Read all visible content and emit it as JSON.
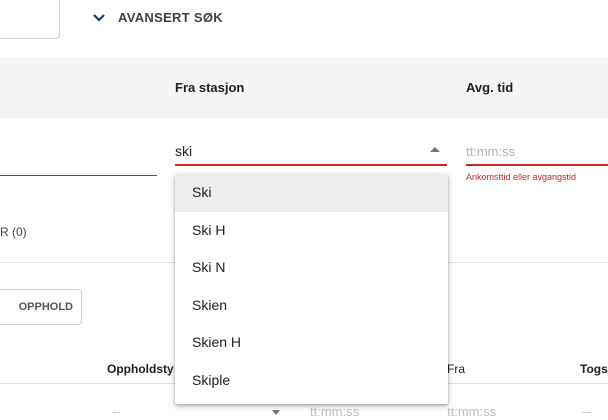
{
  "advanced": {
    "label": "AVANSERT SØK"
  },
  "table_header": {
    "fra": "Fra stasjon",
    "avg": "Avg. tid"
  },
  "fra_field": {
    "value": "ski"
  },
  "avg_field": {
    "placeholder": "tt:mm:ss",
    "error": "Ankomsttid eller avgangstid"
  },
  "count_label": "R (0)",
  "opphold_button": "OPPHOLD",
  "stops_header": {
    "oppholdstype": "Oppholdsty",
    "fra": "Fra",
    "togs": "Togs"
  },
  "row": {
    "dash1": "--",
    "time1": "tt:mm:ss",
    "time2": "tt:mm:ss",
    "dash2": "--"
  },
  "dropdown": {
    "options": [
      "Ski",
      "Ski H",
      "Ski N",
      "Skien",
      "Skien H",
      "Skiple"
    ]
  }
}
